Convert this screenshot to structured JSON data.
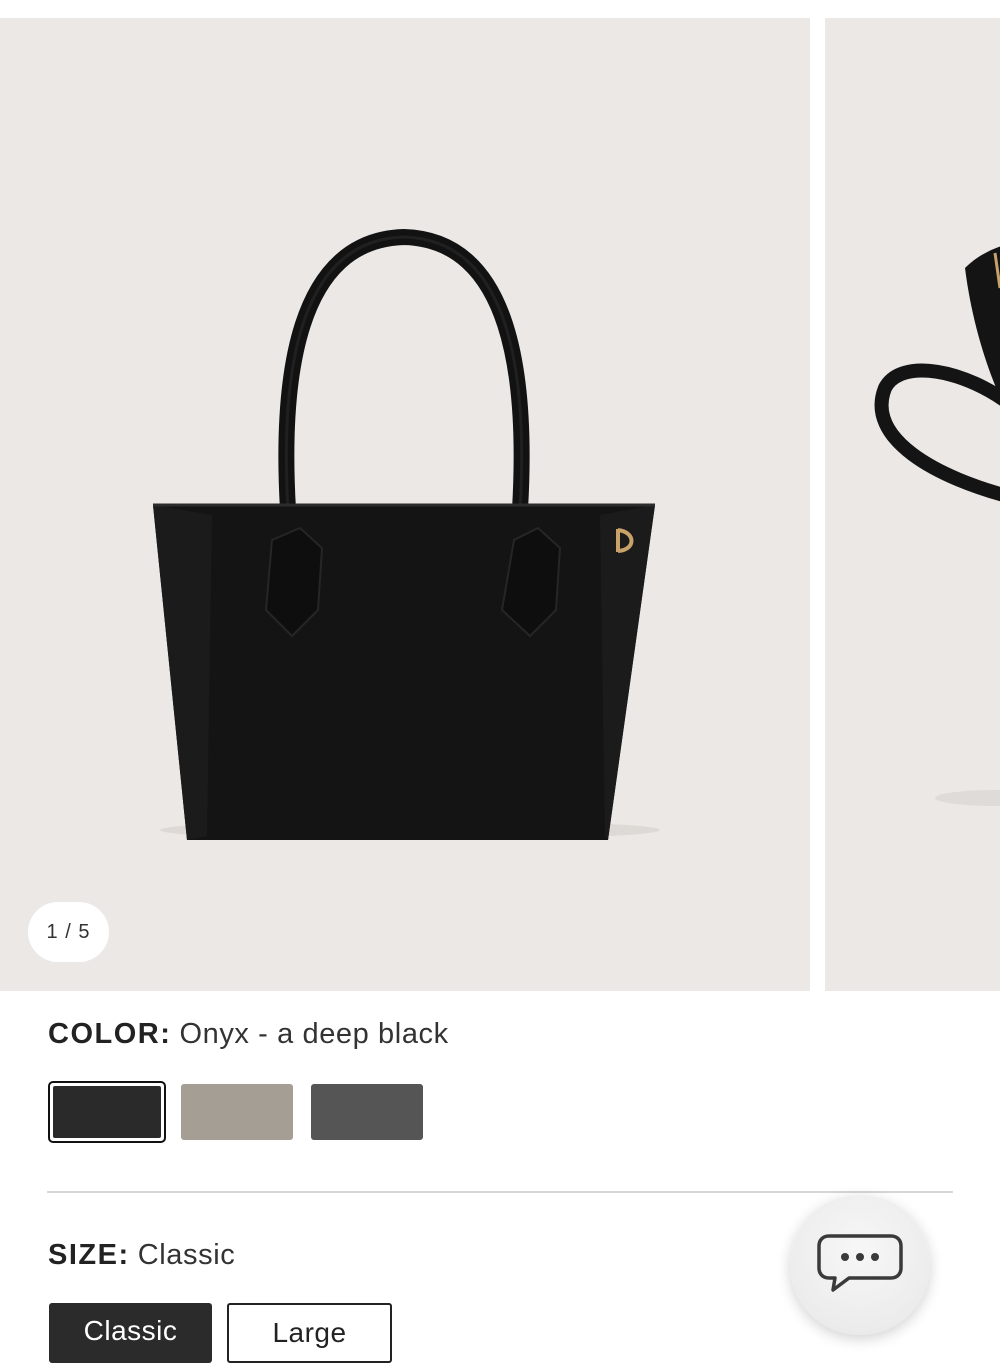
{
  "gallery": {
    "counter": "1 / 5",
    "current_slide": 1,
    "total_slides": 5,
    "background_color": "#ece8e6",
    "product_color": "#141414",
    "hardware_color": "#c9a26a"
  },
  "color_option": {
    "label": "COLOR:",
    "selected_value": "Onyx - a deep black",
    "swatches": [
      {
        "color": "#2a2a2a",
        "selected": true
      },
      {
        "color": "#a49e95",
        "selected": false
      },
      {
        "color": "#555555",
        "selected": false
      }
    ]
  },
  "size_option": {
    "label": "SIZE:",
    "selected_value": "Classic",
    "buttons": [
      {
        "label": "Classic",
        "selected": true
      },
      {
        "label": "Large",
        "selected": false
      }
    ]
  },
  "chat": {
    "icon": "chat-bubble-icon"
  }
}
